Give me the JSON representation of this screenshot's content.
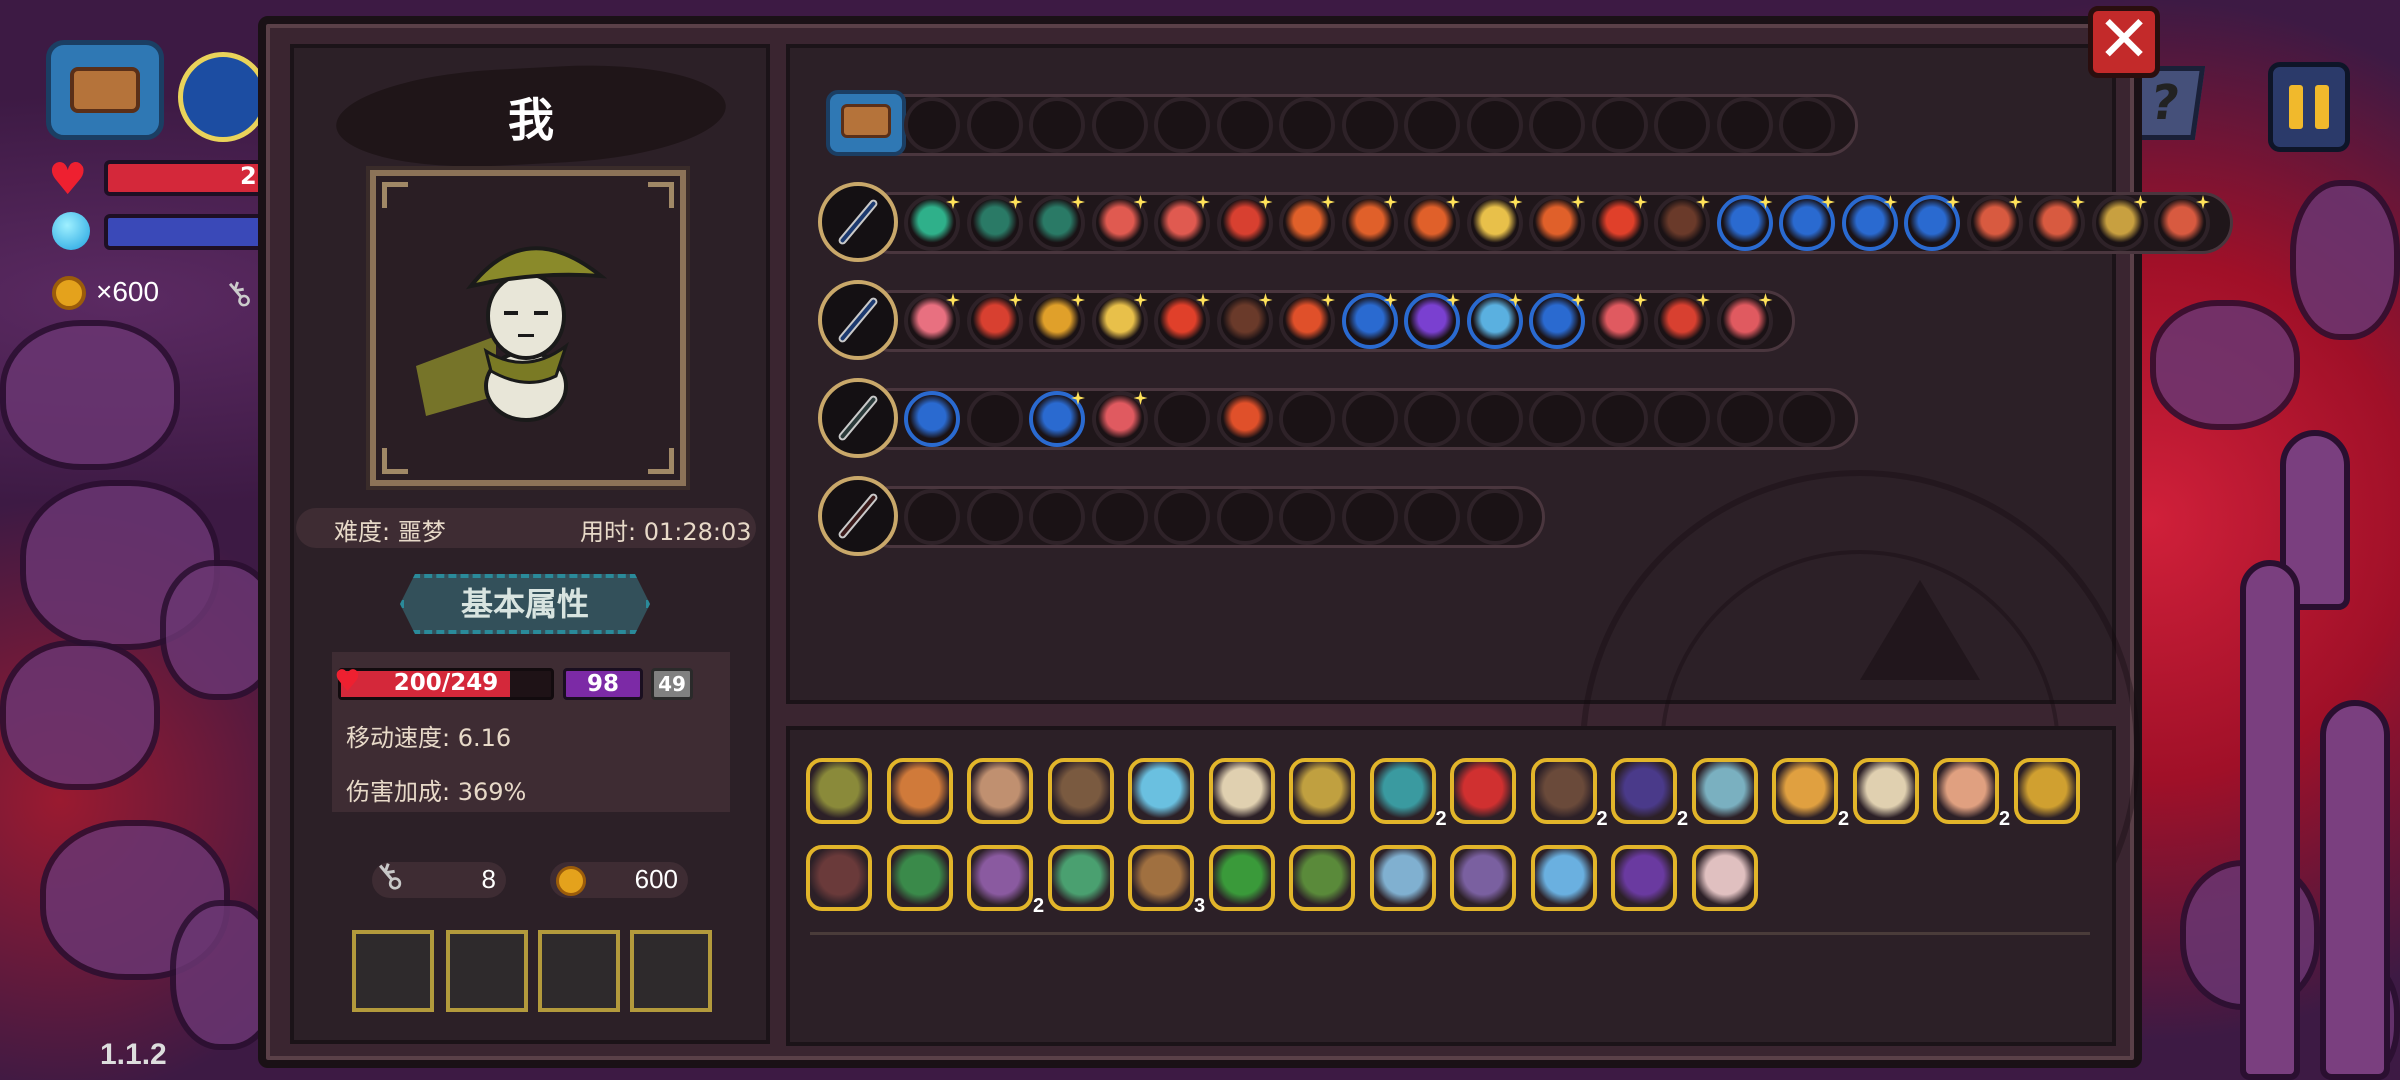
{
  "hud": {
    "hp_partial": "2",
    "coins": "×600",
    "version": "1.1.2"
  },
  "panel": {
    "player_name": "我",
    "difficulty": "难度: 噩梦",
    "time": "用时: 01:28:03",
    "attr_title": "基本属性",
    "stats": {
      "hp_text": "200/249",
      "hp_fraction": 0.803,
      "mana": "98",
      "shield": "49",
      "move_speed": "移动速度: 6.16",
      "damage_bonus": "伤害加成: 369%"
    },
    "keys": "8",
    "gold": "600",
    "close_label": "✕"
  },
  "weapons": [
    {
      "name": "bag",
      "spells": [],
      "empty_slots": 15
    },
    {
      "name": "emerald-wand",
      "spells": [
        {
          "icon": "green-gem-icon",
          "c": "#2fb08a"
        },
        {
          "icon": "green-gem-icon",
          "c": "#2a7a66"
        },
        {
          "icon": "green-gem-icon",
          "c": "#2a7a66"
        },
        {
          "icon": "potion-icon",
          "c": "#e05a50"
        },
        {
          "icon": "potion-icon",
          "c": "#e05a50"
        },
        {
          "icon": "hourglass-icon",
          "c": "#d84030"
        },
        {
          "icon": "fire-bolt-icon",
          "c": "#e0602a"
        },
        {
          "icon": "fire-bolt-icon",
          "c": "#e0602a"
        },
        {
          "icon": "fire-bolt-icon",
          "c": "#e0602a"
        },
        {
          "icon": "card-icon",
          "c": "#e8c04a"
        },
        {
          "icon": "fire-bolt-icon",
          "c": "#e0602a"
        },
        {
          "icon": "burst-icon",
          "c": "#e0402a"
        },
        {
          "icon": "dark-burst-icon",
          "c": "#6a3a2a"
        },
        {
          "icon": "arrow-icon",
          "c": "#2a6ad0",
          "blue": true
        },
        {
          "icon": "crossbolt-icon",
          "c": "#2a6ad0",
          "blue": true
        },
        {
          "icon": "arrow-icon",
          "c": "#2a6ad0",
          "blue": true
        },
        {
          "icon": "arrow-icon",
          "c": "#2a6ad0",
          "blue": true
        },
        {
          "icon": "heart-rune-icon",
          "c": "#d85a40"
        },
        {
          "icon": "heart-rune-icon",
          "c": "#d85a40"
        },
        {
          "icon": "heart-rune-icon",
          "c": "#c8a040"
        },
        {
          "icon": "heart-rune-icon",
          "c": "#d85a40"
        }
      ],
      "empty_slots": 0
    },
    {
      "name": "crystal-staff",
      "spells": [
        {
          "icon": "skull-icon",
          "c": "#e87080"
        },
        {
          "icon": "hourglass-icon",
          "c": "#d84030"
        },
        {
          "icon": "fire-bolt-icon",
          "c": "#e0a02a"
        },
        {
          "icon": "card-icon",
          "c": "#e8c04a"
        },
        {
          "icon": "burst-icon",
          "c": "#e0402a"
        },
        {
          "icon": "dark-burst-icon",
          "c": "#6a3a2a"
        },
        {
          "icon": "triple-icon",
          "c": "#e0502a"
        },
        {
          "icon": "book-icon",
          "c": "#2a6ad0",
          "blue": true
        },
        {
          "icon": "lightning-icon",
          "c": "#7a40d0",
          "blue": true
        },
        {
          "icon": "orb-icon",
          "c": "#5ab0e0",
          "blue": true
        },
        {
          "icon": "arrow-icon",
          "c": "#2a6ad0",
          "blue": true
        },
        {
          "icon": "heart-rune-icon",
          "c": "#e05a60"
        },
        {
          "icon": "hourglass-icon",
          "c": "#d84030"
        },
        {
          "icon": "heart-rune-icon",
          "c": "#e05a60"
        }
      ],
      "empty_slots": 0
    },
    {
      "name": "silver-scepter",
      "spells": [
        {
          "icon": "crossbolt-icon",
          "c": "#2a6ad0",
          "blue": true,
          "plain": true
        },
        {
          "empty": true
        },
        {
          "icon": "crossbolt-icon",
          "c": "#2a6ad0",
          "blue": true
        },
        {
          "icon": "heart-rune-icon",
          "c": "#e05a60"
        },
        {
          "empty": true
        },
        {
          "icon": "triple-icon",
          "c": "#e0502a",
          "plain": true
        }
      ],
      "empty_slots": 9
    },
    {
      "name": "fire-staff",
      "spells": [],
      "empty_slots": 10
    }
  ],
  "items_row1": [
    {
      "icon": "mushroom-hat-icon",
      "c": "#8a8a3a"
    },
    {
      "icon": "scroll-bundle-icon",
      "c": "#d07a3a"
    },
    {
      "icon": "egg-icon",
      "c": "#c09070"
    },
    {
      "icon": "rune-stone-icon",
      "c": "#7a5a40"
    },
    {
      "icon": "key-icon",
      "c": "#6ac0e0"
    },
    {
      "icon": "glasses-icon",
      "c": "#e0d0b0"
    },
    {
      "icon": "hourglass-icon",
      "c": "#c0a040"
    },
    {
      "icon": "spellbook-icon",
      "c": "#3a9aa0",
      "count": "2"
    },
    {
      "icon": "demon-mask-icon",
      "c": "#d03030"
    },
    {
      "icon": "horn-icon",
      "c": "#6a4a3a",
      "count": "2"
    },
    {
      "icon": "cloak-icon",
      "c": "#4a3a8a",
      "count": "2"
    },
    {
      "icon": "compass-icon",
      "c": "#7ab0c0"
    },
    {
      "icon": "horn-icon",
      "c": "#e0a040",
      "count": "2"
    },
    {
      "icon": "wings-icon",
      "c": "#e0d0b0"
    },
    {
      "icon": "pig-icon",
      "c": "#e0a080",
      "count": "2"
    },
    {
      "icon": "goblet-icon",
      "c": "#d0a030"
    }
  ],
  "items_row2": [
    {
      "icon": "bat-cloak-icon",
      "c": "#6a3a3a"
    },
    {
      "icon": "slime-hat-icon",
      "c": "#3a8a4a"
    },
    {
      "icon": "tome-icon",
      "c": "#8a5aa0",
      "count": "2"
    },
    {
      "icon": "leaf-icon",
      "c": "#4aa070"
    },
    {
      "icon": "pickaxe-icon",
      "c": "#a07040",
      "count": "3"
    },
    {
      "icon": "crystal-icon",
      "c": "#3a9a3a"
    },
    {
      "icon": "goblin-icon",
      "c": "#5a8a3a"
    },
    {
      "icon": "slime-icon",
      "c": "#80b0d0"
    },
    {
      "icon": "claw-icon",
      "c": "#7a60a0"
    },
    {
      "icon": "star-flower-icon",
      "c": "#6ab0e0"
    },
    {
      "icon": "wizard-hat-icon",
      "c": "#6a3aa0"
    },
    {
      "icon": "feather-icon",
      "c": "#e0c0c0"
    }
  ]
}
